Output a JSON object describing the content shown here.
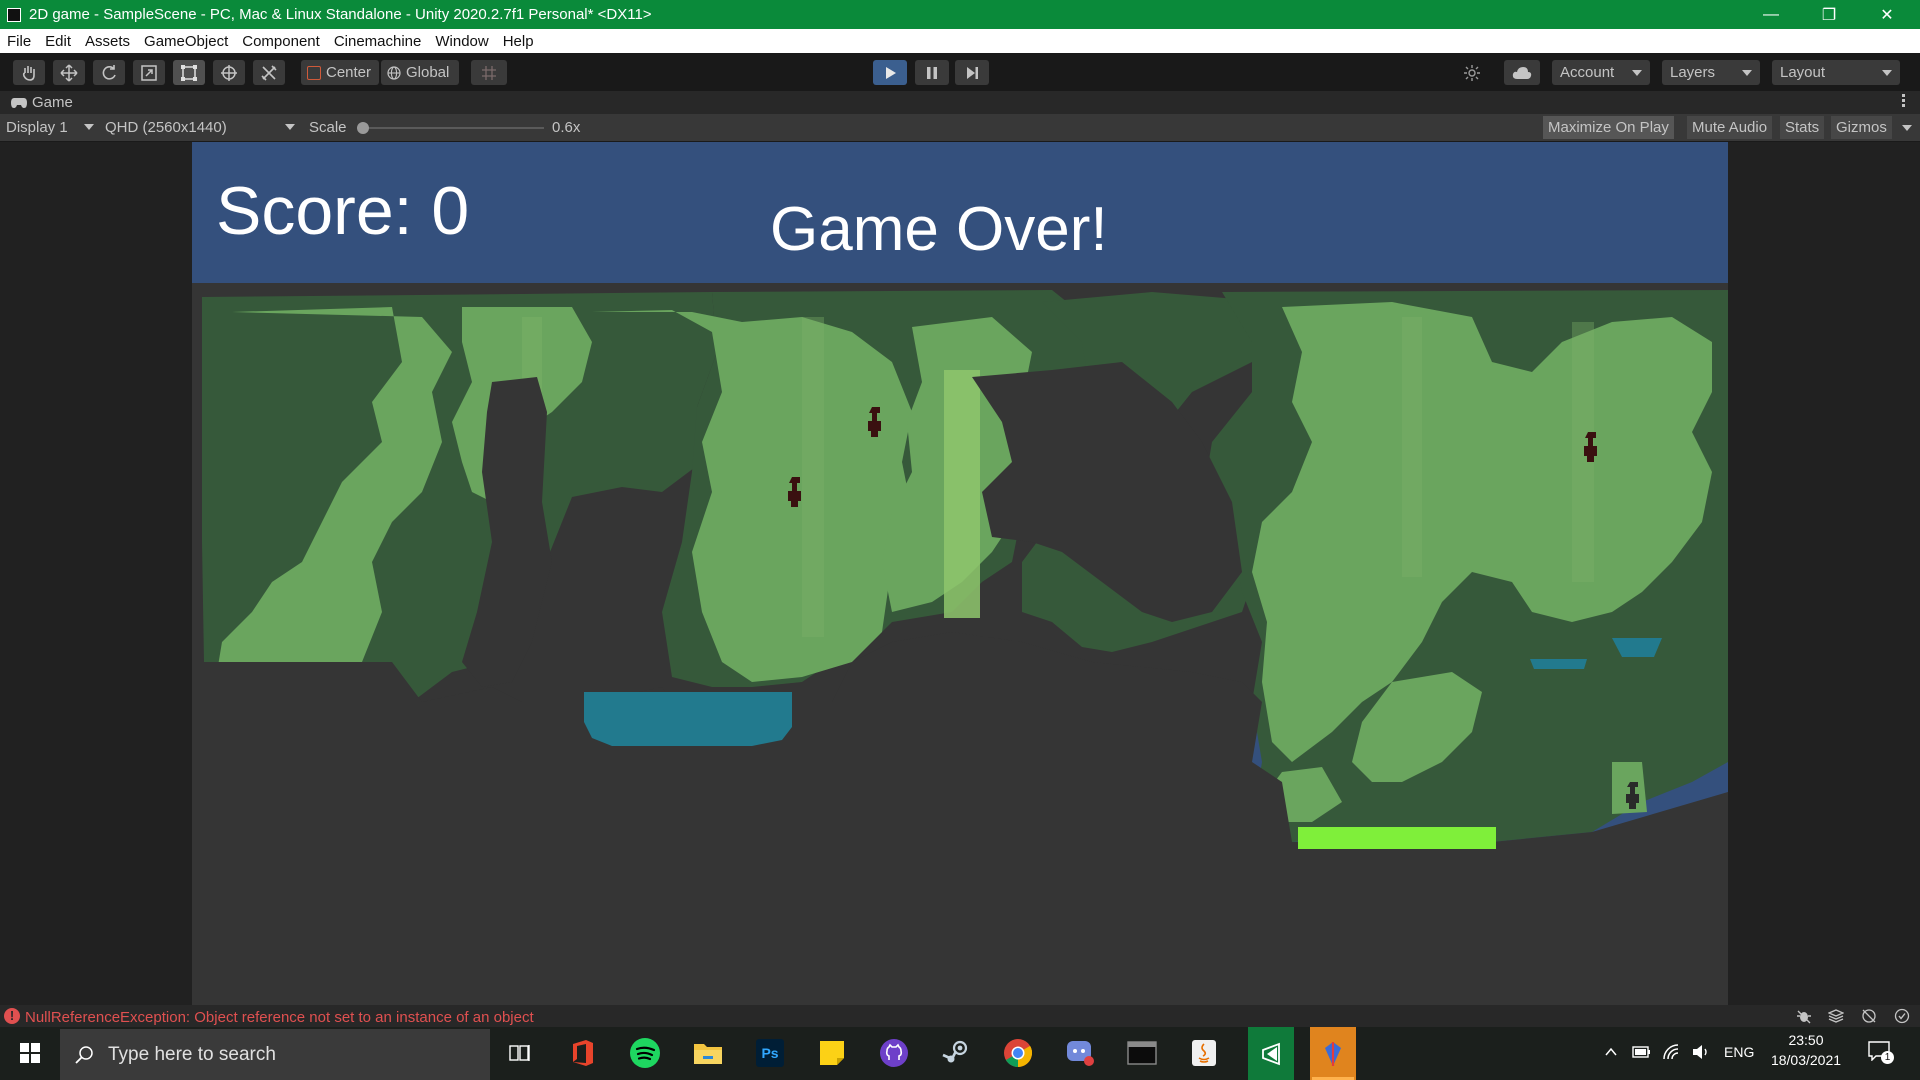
{
  "window": {
    "title": "2D game - SampleScene - PC, Mac & Linux Standalone - Unity 2020.2.7f1 Personal* <DX11>",
    "controls": [
      "minimize-icon",
      "maximize-icon",
      "close-icon"
    ]
  },
  "menu": {
    "items": [
      "File",
      "Edit",
      "Assets",
      "GameObject",
      "Component",
      "Cinemachine",
      "Window",
      "Help"
    ]
  },
  "toolbar": {
    "tools": [
      "hand-icon",
      "move-icon",
      "rotate-icon",
      "scale-icon",
      "rect-icon",
      "transform-icon",
      "custom-tool-icon"
    ],
    "pivot_label": "Center",
    "space_label": "Global",
    "snap_icon": "grid-snap-icon",
    "play_icon": "play-icon",
    "pause_icon": "pause-icon",
    "step_icon": "step-icon",
    "collab_icon": "collab-icon",
    "cloud_icon": "cloud-icon",
    "account_label": "Account",
    "layers_label": "Layers",
    "layout_label": "Layout",
    "play_active_color": "#3b5f8f"
  },
  "game_tab": {
    "label": "Game",
    "icon": "gamepad-icon",
    "display_label": "Display 1",
    "resolution_label": "QHD (2560x1440)",
    "scale_label": "Scale",
    "scale_value": "0.6x",
    "buttons": [
      "Maximize On Play",
      "Mute Audio",
      "Stats",
      "Gizmos"
    ]
  },
  "game": {
    "score_text": "Score: 0",
    "gameover_text": "Game Over!",
    "hud_color": "#34507d",
    "cave_color": "#353535",
    "foliage_dark": "#36593a",
    "foliage_light": "#6aa55e",
    "water_color": "#227a8e",
    "goal_color": "#7fef3a"
  },
  "status": {
    "message": "NullReferenceException: Object reference not set to an instance of an object",
    "error_color": "#e05050",
    "icons": [
      "bug-icon",
      "layers-status-icon",
      "network-icon",
      "check-icon"
    ]
  },
  "taskbar": {
    "search_placeholder": "Type here to search",
    "apps": [
      "task-view-icon",
      "office-icon",
      "spotify-icon",
      "file-explorer-icon",
      "photoshop-icon",
      "sticky-notes-icon",
      "github-icon",
      "steam-icon",
      "chrome-icon",
      "discord-icon",
      "terminal-icon",
      "java-icon",
      "visual-studio-icon",
      "unity-icon"
    ],
    "lang": "ENG",
    "time": "23:50",
    "date": "18/03/2021",
    "notification_count": "1"
  }
}
